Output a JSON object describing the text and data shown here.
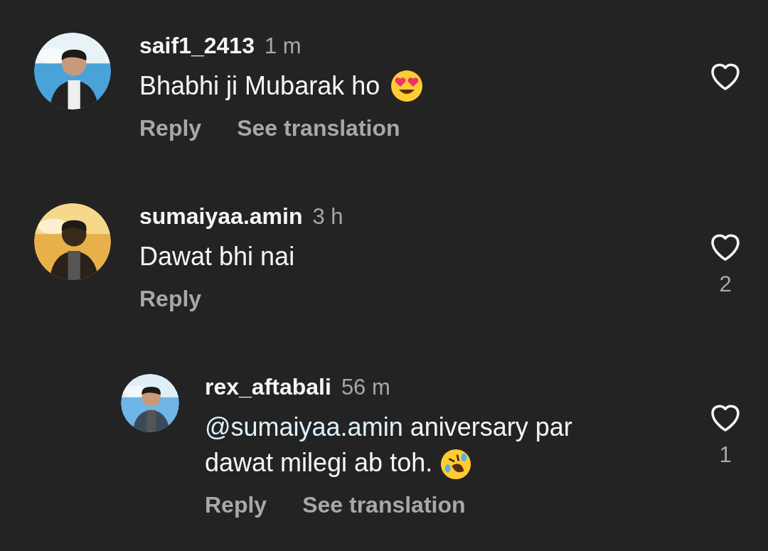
{
  "comments": [
    {
      "username": "saif1_2413",
      "time": "1 m",
      "text": "Bhabhi ji Mubarak ho",
      "actions": [
        "Reply",
        "See translation"
      ],
      "liked": false
    },
    {
      "username": "sumaiyaa.amin",
      "time": "3 h",
      "text": "Dawat bhi nai",
      "actions": [
        "Reply"
      ],
      "liked": false,
      "like_count": "2",
      "replies": [
        {
          "username": "rex_aftabali",
          "time": "56 m",
          "mention": "@sumaiyaa.amin",
          "text": "aniversary par dawat milegi ab toh.",
          "actions": [
            "Reply",
            "See translation"
          ],
          "liked": false,
          "like_count": "1"
        }
      ]
    }
  ]
}
